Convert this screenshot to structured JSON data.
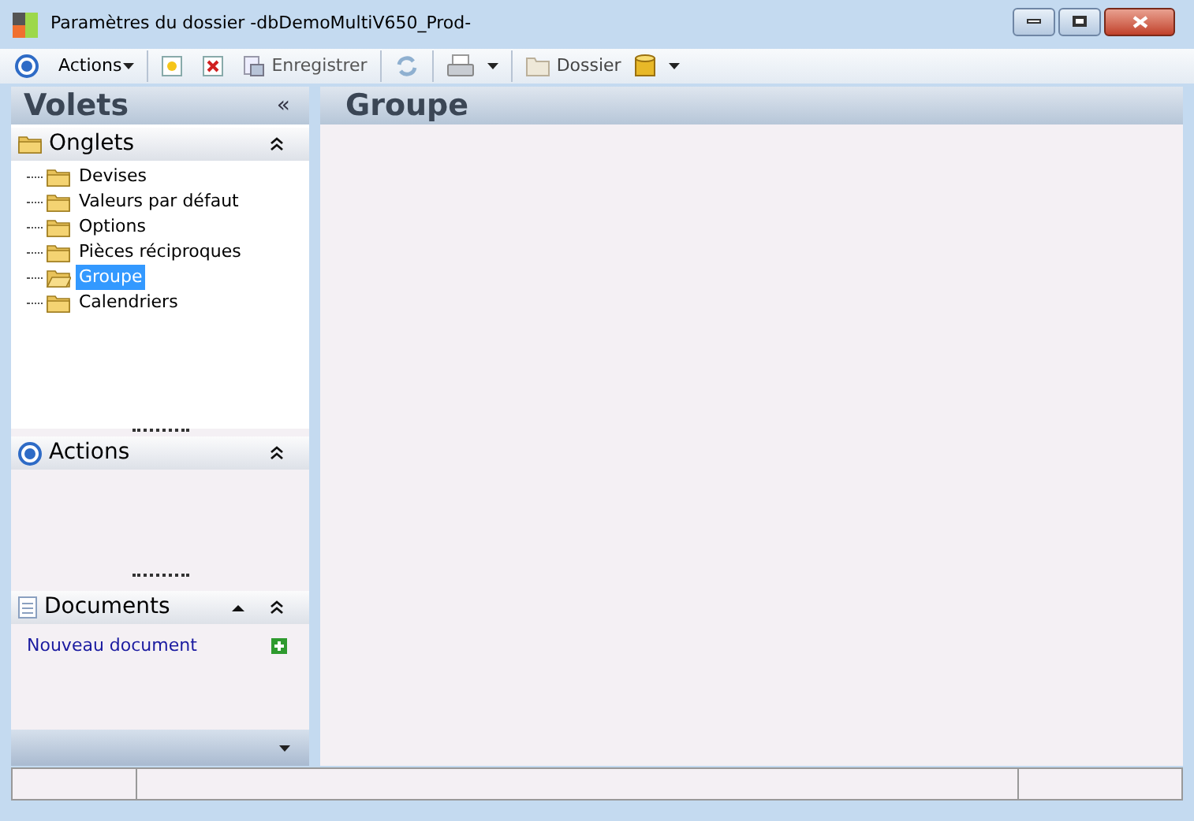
{
  "window": {
    "title": "Paramètres du dossier -dbDemoMultiV650_Prod-"
  },
  "toolbar": {
    "actions_menu": "Actions",
    "save": "Enregistrer",
    "folder": "Dossier"
  },
  "sidebar": {
    "title": "Volets",
    "collapse": "«",
    "onglets": {
      "title": "Onglets",
      "items": [
        {
          "label": "Devises",
          "selected": false
        },
        {
          "label": "Valeurs par défaut",
          "selected": false
        },
        {
          "label": "Options",
          "selected": false
        },
        {
          "label": "Pièces réciproques",
          "selected": false
        },
        {
          "label": "Groupe",
          "selected": true
        },
        {
          "label": "Calendriers",
          "selected": false
        }
      ]
    },
    "actions": {
      "title": "Actions"
    },
    "documents": {
      "title": "Documents",
      "link": "Nouveau document"
    }
  },
  "main": {
    "title": "Groupe"
  }
}
